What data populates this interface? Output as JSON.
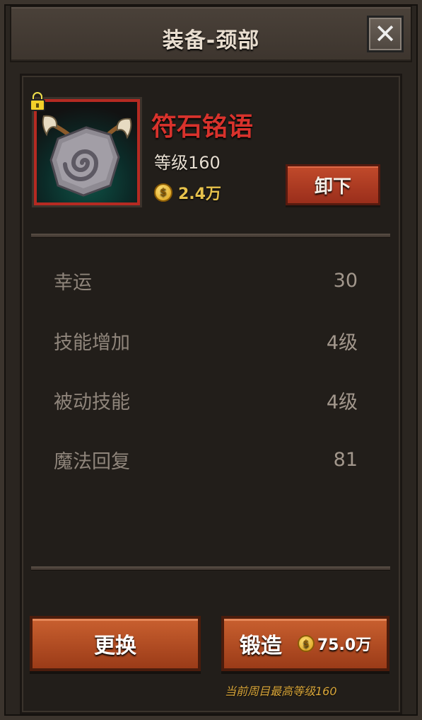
{
  "header": {
    "title": "装备-颈部",
    "close_label": "✕"
  },
  "item": {
    "name": "符石铭语",
    "level": "等级160",
    "price": "2.4万",
    "locked_icon": "lock-icon",
    "unequip_label": "卸下"
  },
  "stats": [
    {
      "name": "幸运",
      "value": "30"
    },
    {
      "name": "技能增加",
      "value": "4级"
    },
    {
      "name": "被动技能",
      "value": "4级"
    },
    {
      "name": "魔法回复",
      "value": "81"
    }
  ],
  "actions": {
    "replace_label": "更换",
    "forge_label": "锻造",
    "forge_cost": "75.0万"
  },
  "footnote": "当前周目最高等级160",
  "colors": {
    "item_name": "#d8322c",
    "gold": "#e7c24c",
    "button_orange": "#c9602f",
    "button_red": "#c14a2b"
  }
}
